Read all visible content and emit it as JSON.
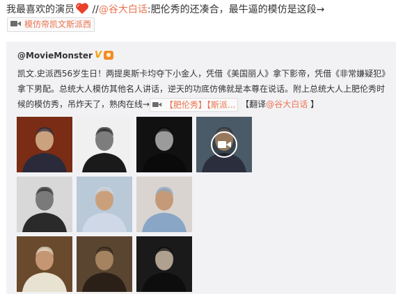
{
  "post": {
    "text_lead": "我最喜欢的演员",
    "text_sep": " //",
    "mention": "@谷大白话",
    "text_rest": ":肥伦秀的还凑合，最牛逼的模仿是这段→",
    "video_tag": "模仿帝凯文斯派西"
  },
  "repost": {
    "author": "@MovieMonster",
    "verified_mark": "V",
    "body_main": "凯文.史派西56岁生日！两提奥斯卡均夺下小金人，凭借《美国丽人》拿下影帝，凭借《非常嫌疑犯》拿下男配。总统大人模仿其他名人讲话，逆天的功底仿佛就是本尊在说话。附上总统大人上肥伦秀时候的模仿秀，吊炸天了，熟肉在线→",
    "video_tag_a": "【肥伦秀】",
    "video_tag_b": "【斯派...",
    "translate_prefix": " 【翻译",
    "translate_mention": "@谷大白话",
    "translate_suffix": " 】"
  },
  "photos": [
    {
      "subject": "portrait-suit-red-bg",
      "bg": "#7a2d14",
      "fg": "#caa27e",
      "shirt": "#2a2a3a"
    },
    {
      "subject": "portrait-bw-hands",
      "bg": "#f0f0f0",
      "fg": "#7d7d7d",
      "shirt": "#1a1a1a"
    },
    {
      "subject": "portrait-bw-gesture",
      "bg": "#111111",
      "fg": "#9b9b9b",
      "shirt": "#0a0a0a"
    },
    {
      "subject": "video-still",
      "bg": "#4a5a66",
      "fg": "#c9a27c",
      "shirt": "#2b2f3d"
    },
    {
      "subject": "portrait-bw-sitting",
      "bg": "#d8d8d8",
      "fg": "#7a7a7a",
      "shirt": "#2a2a2a"
    },
    {
      "subject": "portrait-blue-shirt",
      "bg": "#b9c9d8",
      "fg": "#caa07c",
      "shirt": "#cfd8e6"
    },
    {
      "subject": "portrait-smiling",
      "bg": "#d9d4cf",
      "fg": "#c59a78",
      "shirt": "#8aa6c6"
    },
    {
      "subject": "portrait-vest-room",
      "bg": "#6a4a2c",
      "fg": "#c59674",
      "shirt": "#e8e2d2"
    },
    {
      "subject": "stage-scene",
      "bg": "#5a4630",
      "fg": "#a58260",
      "shirt": "#2a2018"
    },
    {
      "subject": "throne-dark",
      "bg": "#1a1a1a",
      "fg": "#b0a090",
      "shirt": "#0d0d0d"
    }
  ],
  "colors": {
    "link": "#eb7350",
    "repost_bg": "#f2f2f5",
    "verified": "#f3a200"
  }
}
